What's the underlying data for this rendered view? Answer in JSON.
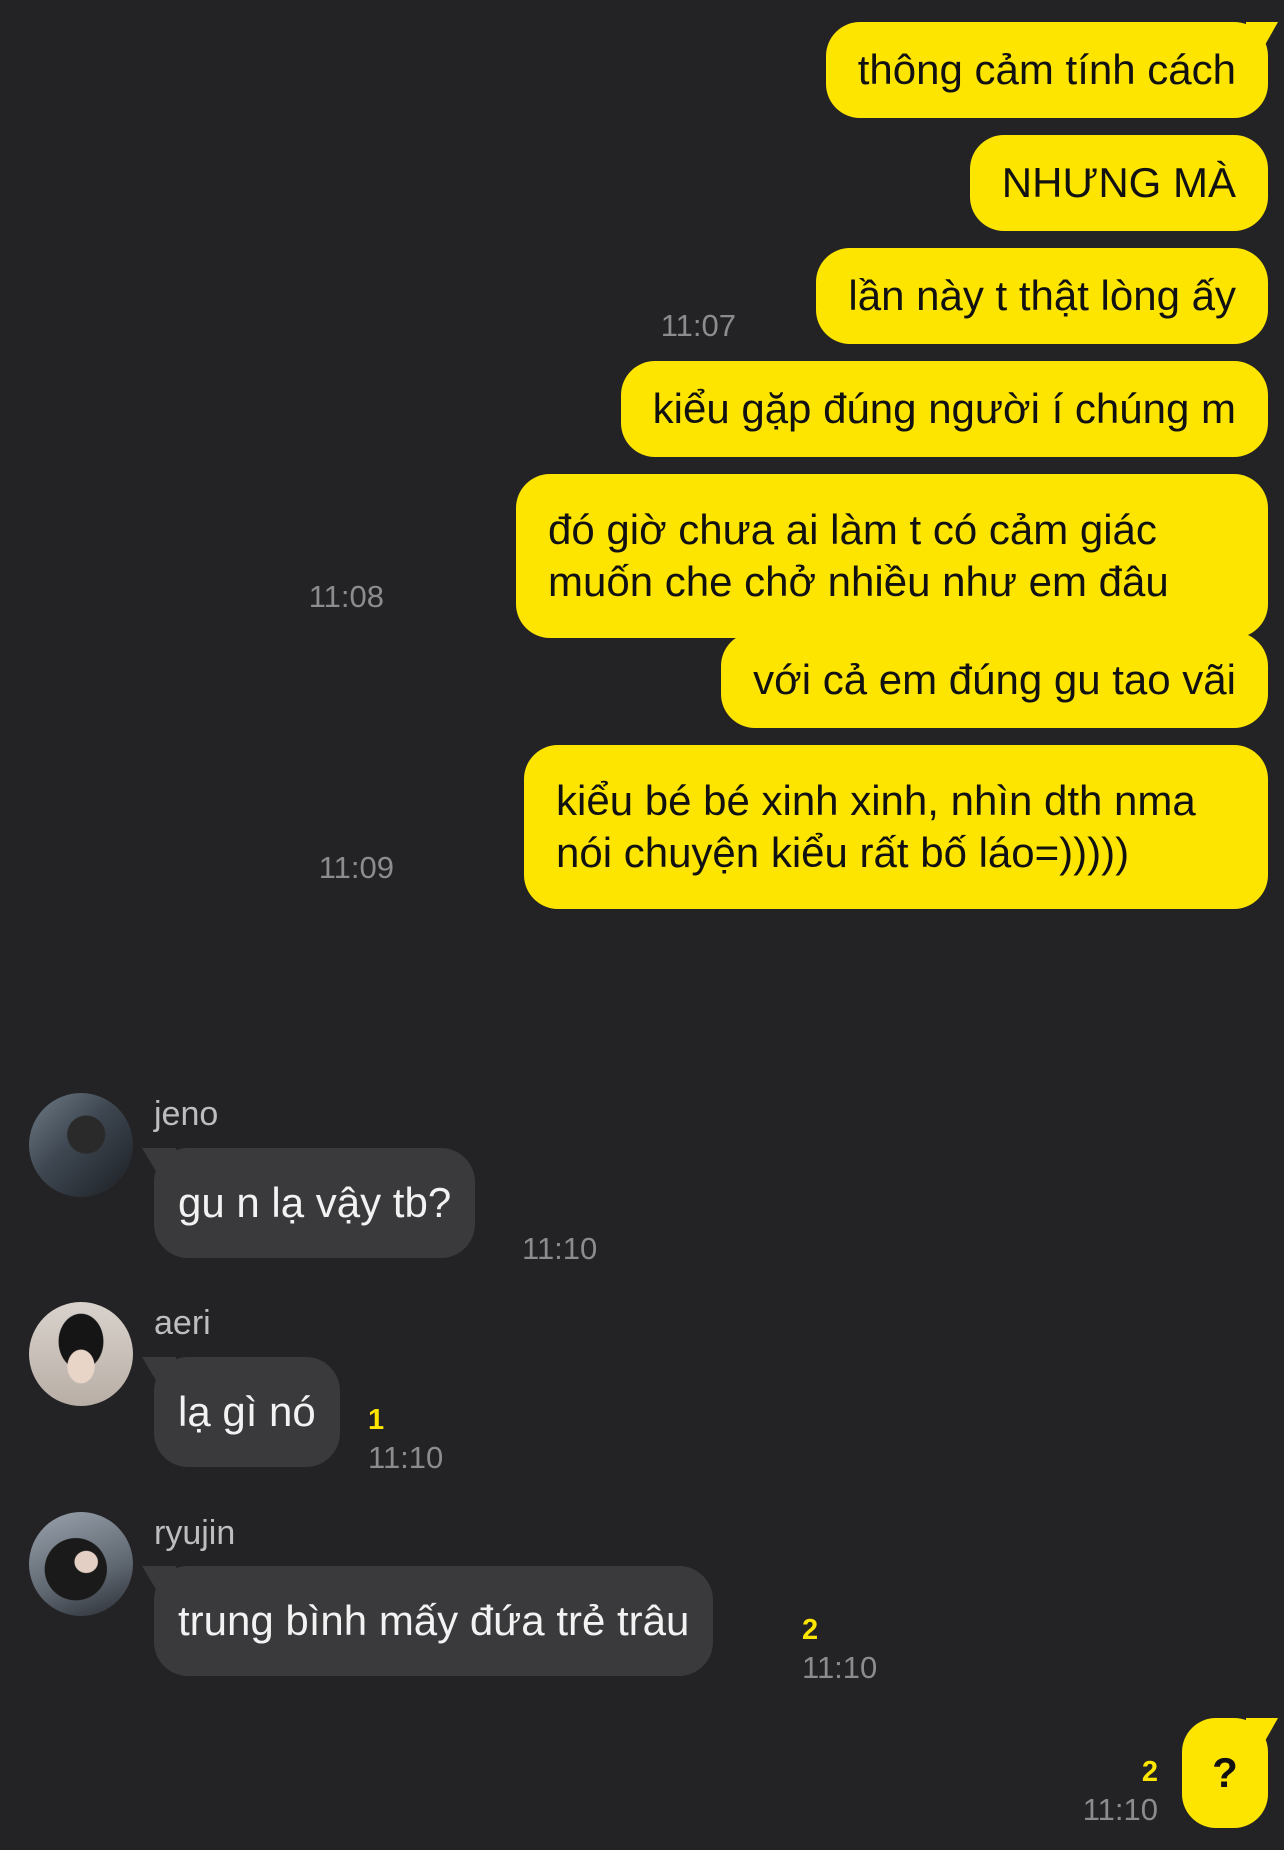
{
  "colors": {
    "background": "#232325",
    "outgoing_bubble": "#fee500",
    "incoming_bubble": "#3a3a3c",
    "timestamp": "#8c8c8e",
    "unread_count": "#fee500"
  },
  "messages": [
    {
      "side": "out",
      "text": "thông cảm tính cách"
    },
    {
      "side": "out",
      "text": "NHƯNG MÀ"
    },
    {
      "side": "out",
      "text": "lần này t thật lòng ấy",
      "time": "11:07"
    },
    {
      "side": "out",
      "text": "kiểu gặp đúng người í chúng m"
    },
    {
      "side": "out",
      "text": "đó giờ chưa ai làm t có cảm giác muốn che chở nhiều như em đâu",
      "time": "11:08"
    },
    {
      "side": "out",
      "text": "với cả em đúng gu tao vãi"
    },
    {
      "side": "out",
      "text": "kiểu bé bé xinh xinh, nhìn dth nma nói chuyện kiểu rất bố láo=)))))",
      "time": "11:09"
    },
    {
      "side": "in",
      "sender": "jeno",
      "avatar": "jeno-avatar",
      "text": "gu n lạ vậy tb?",
      "time": "11:10"
    },
    {
      "side": "in",
      "sender": "aeri",
      "avatar": "aeri-avatar",
      "text": "lạ gì nó",
      "unread": "1",
      "time": "11:10"
    },
    {
      "side": "in",
      "sender": "ryujin",
      "avatar": "ryujin-avatar",
      "text": "trung bình mấy đứa trẻ trâu",
      "unread": "2",
      "time": "11:10"
    },
    {
      "side": "out",
      "text": "?",
      "unread": "2",
      "time": "11:10"
    }
  ]
}
